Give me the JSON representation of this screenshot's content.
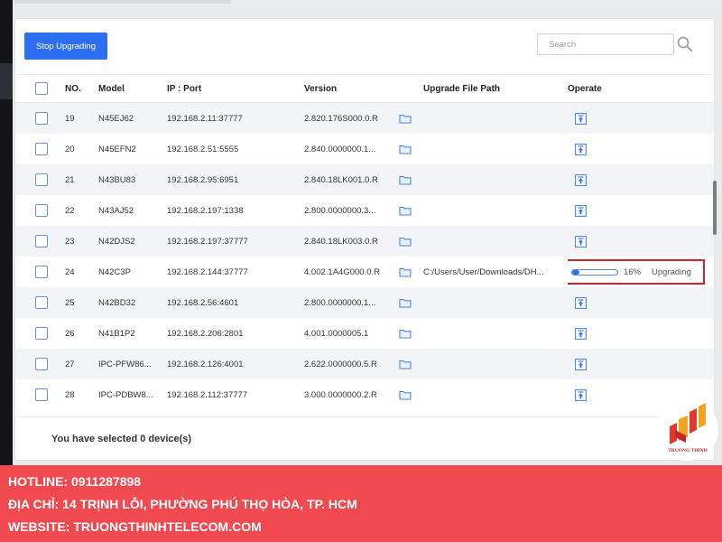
{
  "toolbar": {
    "stop_button": "Stop Upgrading",
    "search_placeholder": "Search"
  },
  "table": {
    "headers": {
      "no": "NO.",
      "model": "Model",
      "ip": "IP : Port",
      "version": "Version",
      "path": "Upgrade File Path",
      "operate": "Operate"
    },
    "rows": [
      {
        "no": "19",
        "model": "N45EJ62",
        "ip": "192.168.2.11:37777",
        "version": "2.820.176S000.0.R",
        "path": "",
        "status": ""
      },
      {
        "no": "20",
        "model": "N45EFN2",
        "ip": "192.168.2.51:5555",
        "version": "2.840.0000000.1...",
        "path": "",
        "status": ""
      },
      {
        "no": "21",
        "model": "N43BU83",
        "ip": "192.168.2.95:6951",
        "version": "2.840.18LK001.0.R",
        "path": "",
        "status": ""
      },
      {
        "no": "22",
        "model": "N43AJ52",
        "ip": "192.168.2.197:1338",
        "version": "2.800.0000000.3...",
        "path": "",
        "status": ""
      },
      {
        "no": "23",
        "model": "N42DJS2",
        "ip": "192.168.2.197:37777",
        "version": "2.840.18LK003.0.R",
        "path": "",
        "status": ""
      },
      {
        "no": "24",
        "model": "N42C3P",
        "ip": "192.168.2.144:37777",
        "version": "4.002.1A4G000.0.R",
        "path": "C:/Users/User/Downloads/DH...",
        "progress_pct": 16,
        "progress_label": "16%",
        "status": "Upgrading"
      },
      {
        "no": "25",
        "model": "N42BD32",
        "ip": "192.168.2.56:4601",
        "version": "2.800.0000000.1...",
        "path": "",
        "status": ""
      },
      {
        "no": "26",
        "model": "N41B1P2",
        "ip": "192.168.2.206:2801",
        "version": "4.001.0000005.1",
        "path": "",
        "status": ""
      },
      {
        "no": "27",
        "model": "IPC-PFW86...",
        "ip": "192.168.2.126:4001",
        "version": "2.622.0000000.5.R",
        "path": "",
        "status": ""
      },
      {
        "no": "28",
        "model": "IPC-PDBW8...",
        "ip": "192.168.2.112:37777",
        "version": "3.000.0000000.2.R",
        "path": "",
        "status": ""
      }
    ]
  },
  "footer": {
    "selected_text": "You have selected 0  device(s)"
  },
  "logo": {
    "text": "TRUONG THINH"
  },
  "banner": {
    "hotline": "HOTLINE: 0911287898",
    "address": "ĐỊA CHỈ: 14 TRỊNH LỖI, PHƯỜNG PHÚ THỌ HÒA, TP. HCM",
    "website": "WEBSITE: TRUONGTHINHTELECOM.COM"
  },
  "colors": {
    "accent": "#2e6ff2",
    "highlight_border": "#d7222b",
    "banner": "#f0494f"
  },
  "icons": {
    "folder": "folder-icon",
    "upgrade": "upload-icon",
    "search": "search-icon"
  }
}
